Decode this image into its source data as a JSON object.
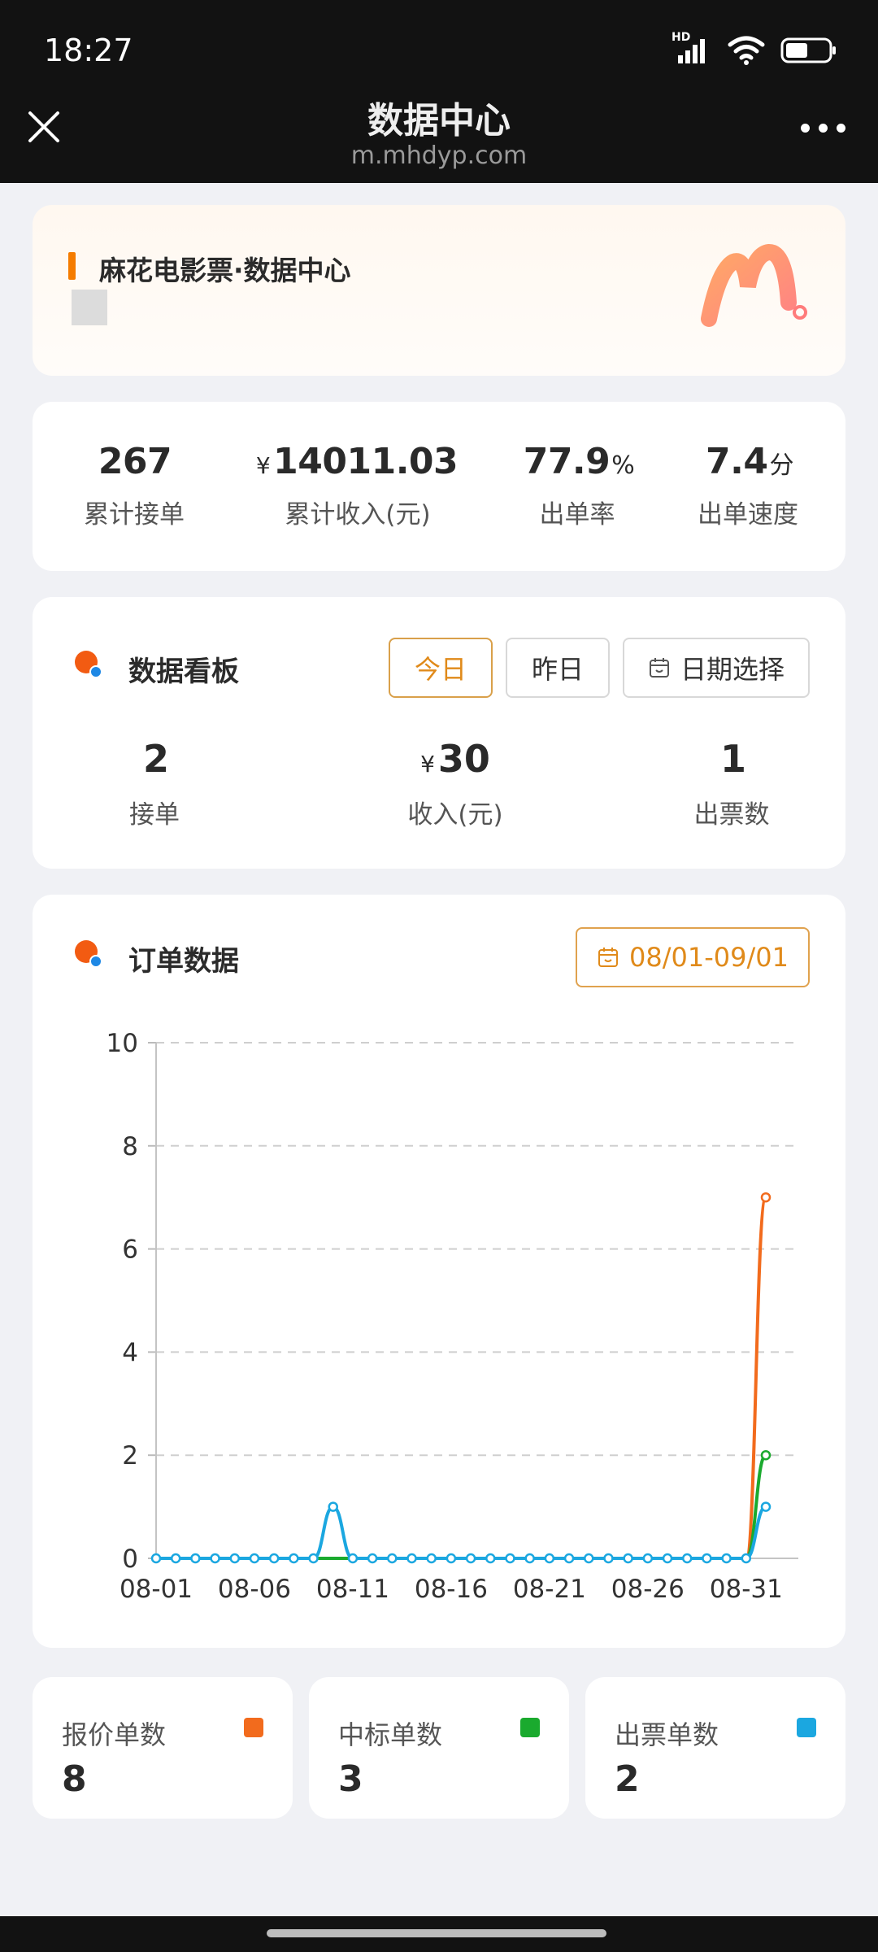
{
  "status": {
    "time": "18:27",
    "hd": "HD"
  },
  "nav": {
    "title": "数据中心",
    "subtitle": "m.mhdyp.com"
  },
  "banner": {
    "title": "麻花电影票·数据中心"
  },
  "stats": [
    {
      "currency": "",
      "value": "267",
      "unit": "",
      "label": "累计接单"
    },
    {
      "currency": "¥",
      "value": "14011.03",
      "unit": "",
      "label": "累计收入(元)"
    },
    {
      "currency": "",
      "value": "77.9",
      "unit": "%",
      "label": "出单率"
    },
    {
      "currency": "",
      "value": "7.4",
      "unit": "分",
      "label": "出单速度"
    }
  ],
  "board": {
    "title": "数据看板",
    "tabs": {
      "today": "今日",
      "yesterday": "昨日",
      "date_select": "日期选择"
    },
    "values": [
      {
        "currency": "",
        "value": "2",
        "label": "接单"
      },
      {
        "currency": "¥",
        "value": "30",
        "label": "收入(元)"
      },
      {
        "currency": "",
        "value": "1",
        "label": "出票数"
      }
    ]
  },
  "orders": {
    "title": "订单数据",
    "date_range": "08/01-09/01"
  },
  "chart_data": {
    "type": "line",
    "title": "",
    "xlabel": "",
    "ylabel": "",
    "ylim": [
      0,
      10
    ],
    "yticks": [
      0,
      2,
      4,
      6,
      8,
      10
    ],
    "grid": true,
    "x": [
      "08-01",
      "08-02",
      "08-03",
      "08-04",
      "08-05",
      "08-06",
      "08-07",
      "08-08",
      "08-09",
      "08-10",
      "08-11",
      "08-12",
      "08-13",
      "08-14",
      "08-15",
      "08-16",
      "08-17",
      "08-18",
      "08-19",
      "08-20",
      "08-21",
      "08-22",
      "08-23",
      "08-24",
      "08-25",
      "08-26",
      "08-27",
      "08-28",
      "08-29",
      "08-30",
      "08-31",
      "09-01"
    ],
    "xtick_labels": [
      "08-01",
      "08-06",
      "08-11",
      "08-16",
      "08-21",
      "08-26",
      "08-31"
    ],
    "series": [
      {
        "color": "#f26b1d",
        "values": [
          0,
          0,
          0,
          0,
          0,
          0,
          0,
          0,
          0,
          0,
          0,
          0,
          0,
          0,
          0,
          0,
          0,
          0,
          0,
          0,
          0,
          0,
          0,
          0,
          0,
          0,
          0,
          0,
          0,
          0,
          0,
          7
        ]
      },
      {
        "color": "#1aaa2e",
        "values": [
          0,
          0,
          0,
          0,
          0,
          0,
          0,
          0,
          0,
          0,
          0,
          0,
          0,
          0,
          0,
          0,
          0,
          0,
          0,
          0,
          0,
          0,
          0,
          0,
          0,
          0,
          0,
          0,
          0,
          0,
          0,
          2
        ]
      },
      {
        "color": "#1ba7e0",
        "values": [
          0,
          0,
          0,
          0,
          0,
          0,
          0,
          0,
          0,
          1,
          0,
          0,
          0,
          0,
          0,
          0,
          0,
          0,
          0,
          0,
          0,
          0,
          0,
          0,
          0,
          0,
          0,
          0,
          0,
          0,
          0,
          1
        ]
      }
    ]
  },
  "summary": [
    {
      "label": "报价单数",
      "value": "8",
      "color": "#f26b1d"
    },
    {
      "label": "中标单数",
      "value": "3",
      "color": "#1aaa2e"
    },
    {
      "label": "出票单数",
      "value": "2",
      "color": "#1ba7e0"
    }
  ]
}
